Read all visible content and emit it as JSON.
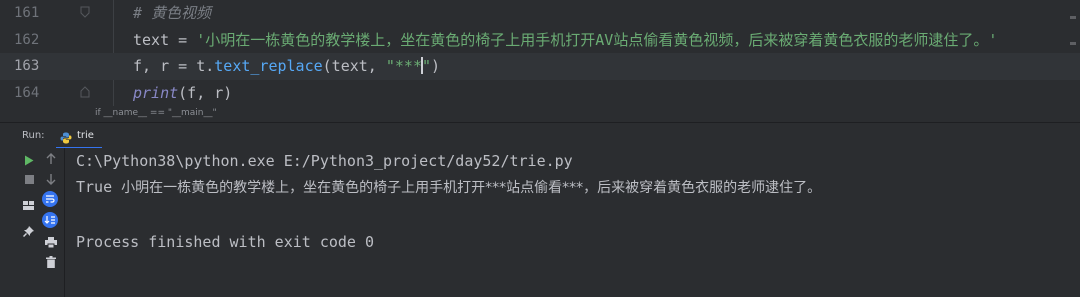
{
  "editor": {
    "lines": [
      {
        "num": "161",
        "text": "# 黄色视频"
      },
      {
        "num": "162",
        "keyword": "text",
        "assign": " = ",
        "string": "'小明在一栋黄色的教学楼上，坐在黄色的椅子上用手机打开AV站点偷看黄色视频，后来被穿着黄色衣服的老师逮住了。'"
      },
      {
        "num": "163",
        "part1": "f, r = t.",
        "method": "text_replace",
        "part2": "(text, ",
        "str_before_caret": "\"***",
        "str_after_caret": "\"",
        "close": ")"
      },
      {
        "num": "164",
        "builtin": "print",
        "rest": "(f, r)"
      }
    ],
    "breadcrumb": "if __name__ == \"__main__\""
  },
  "run": {
    "label": "Run:",
    "tab_name": "trie",
    "icons": {
      "rerun": "play-icon",
      "stop": "stop-icon",
      "layout": "layout-icon",
      "pin": "pin-icon",
      "up": "arrow-up-icon",
      "down": "arrow-down-icon",
      "wrap": "soft-wrap-icon",
      "scroll": "scroll-to-end-icon",
      "print": "print-icon",
      "trash": "trash-icon"
    }
  },
  "console": {
    "command": "C:\\Python38\\python.exe E:/Python3_project/day52/trie.py",
    "result_bool": "True",
    "result_text": "小明在一栋黄色的教学楼上，坐在黄色的椅子上用手机打开***站点偷看***，后来被穿着黄色衣服的老师逮住了。",
    "exit_message": "Process finished with exit code 0"
  },
  "colors": {
    "background": "#2b2d30",
    "string": "#6aab73",
    "comment": "#7a7e85",
    "method": "#56a8f5",
    "builtin": "#8888c6",
    "accent": "#3574f0",
    "run_green": "#5fb865"
  }
}
